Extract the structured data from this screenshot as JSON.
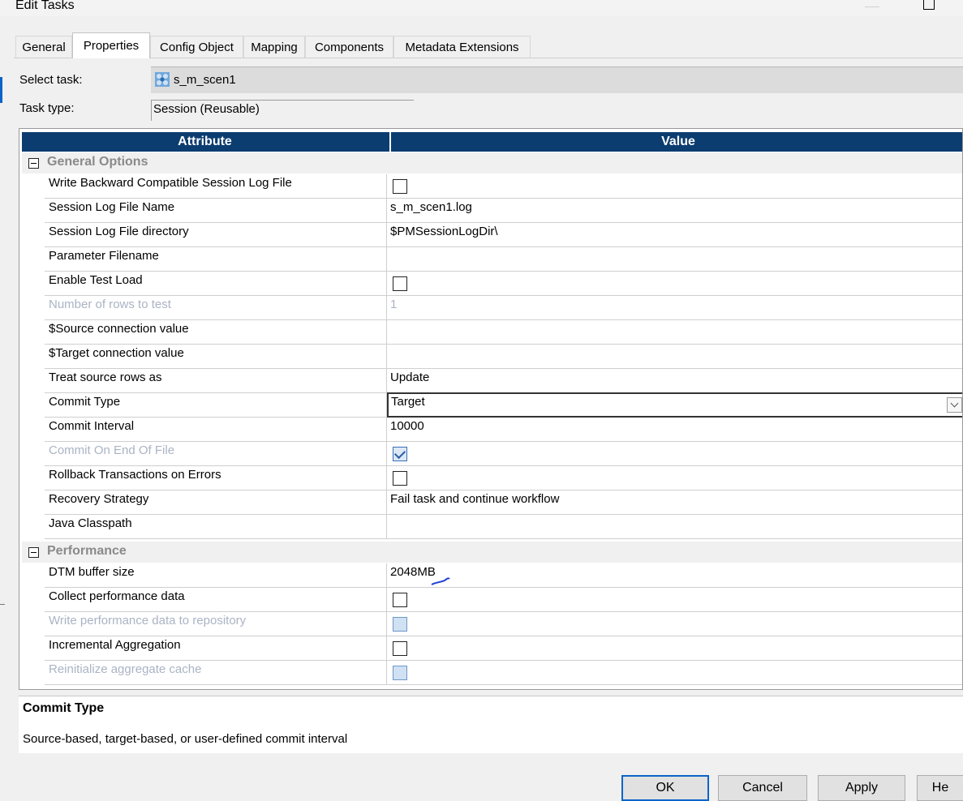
{
  "window": {
    "title": "Edit Tasks"
  },
  "tabs": [
    {
      "label": "General"
    },
    {
      "label": "Properties",
      "active": true
    },
    {
      "label": "Config Object"
    },
    {
      "label": "Mapping"
    },
    {
      "label": "Components"
    },
    {
      "label": "Metadata Extensions"
    }
  ],
  "task": {
    "select_label": "Select task:",
    "select_value": "s_m_scen1",
    "type_label": "Task type:",
    "type_value": "Session (Reusable)"
  },
  "grid": {
    "header_attribute": "Attribute",
    "header_value": "Value",
    "groups": [
      {
        "name": "General Options",
        "rows": [
          {
            "attr": "Write Backward Compatible Session Log File",
            "type": "checkbox",
            "checked": false
          },
          {
            "attr": "Session Log File Name",
            "value": "s_m_scen1.log"
          },
          {
            "attr": "Session Log File directory",
            "value": "$PMSessionLogDir\\"
          },
          {
            "attr": "Parameter Filename",
            "value": ""
          },
          {
            "attr": "Enable Test Load",
            "type": "checkbox",
            "checked": false
          },
          {
            "attr": "Number of rows to test",
            "value": "1",
            "disabled": true
          },
          {
            "attr": "$Source connection value",
            "value": ""
          },
          {
            "attr": "$Target connection value",
            "value": ""
          },
          {
            "attr": "Treat source rows as",
            "value": "Update"
          },
          {
            "attr": "Commit Type",
            "value": "Target",
            "type": "dropdown"
          },
          {
            "attr": "Commit Interval",
            "value": "10000"
          },
          {
            "attr": "Commit On End Of File",
            "type": "checkbox",
            "checked": true,
            "disabled": true
          },
          {
            "attr": "Rollback Transactions on Errors",
            "type": "checkbox",
            "checked": false
          },
          {
            "attr": "Recovery Strategy",
            "value": "Fail task and continue workflow"
          },
          {
            "attr": "Java Classpath",
            "value": ""
          }
        ]
      },
      {
        "name": "Performance",
        "rows": [
          {
            "attr": "DTM buffer size",
            "value": "2048MB"
          },
          {
            "attr": "Collect performance data",
            "type": "checkbox",
            "checked": false
          },
          {
            "attr": "Write performance data to repository",
            "type": "checkbox",
            "checked": false,
            "disabled": true
          },
          {
            "attr": "Incremental Aggregation",
            "type": "checkbox",
            "checked": false
          },
          {
            "attr": "Reinitialize aggregate cache",
            "type": "checkbox",
            "checked": false,
            "disabled": true
          }
        ]
      }
    ]
  },
  "description": {
    "title": "Commit Type",
    "text": "Source-based, target-based, or user-defined commit interval"
  },
  "buttons": {
    "ok": "OK",
    "cancel": "Cancel",
    "apply": "Apply",
    "help": "He"
  },
  "colors": {
    "header_bg": "#0b3d70",
    "accent": "#0a64c8",
    "disabled_text": "#aab4c4"
  }
}
